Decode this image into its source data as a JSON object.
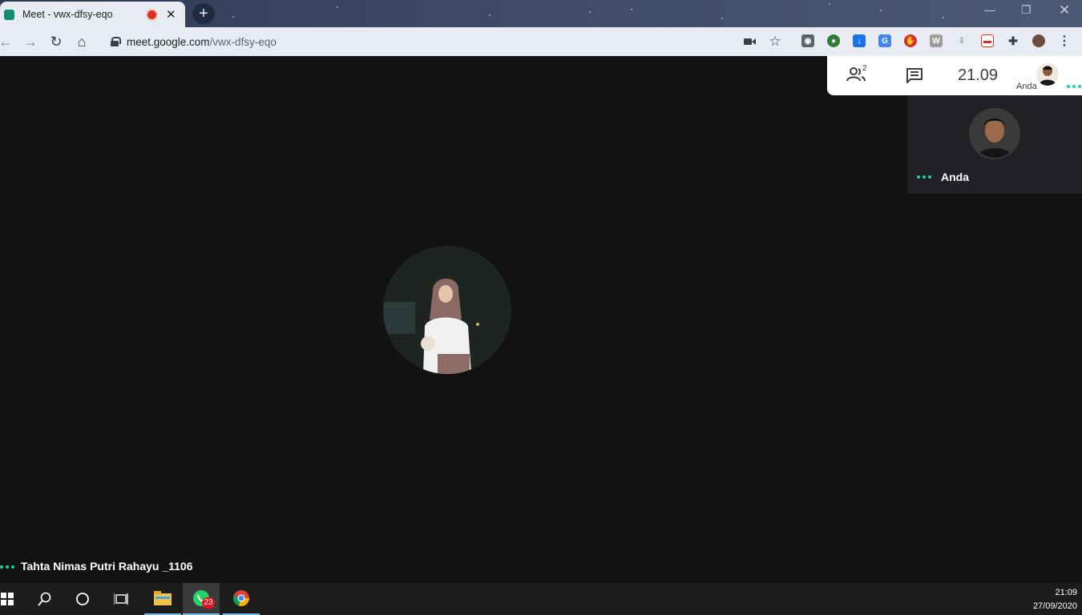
{
  "browser": {
    "tab_title": "Meet - vwx-dfsy-eqo",
    "url_host": "meet.google.com",
    "url_path": "/vwx-dfsy-eqo"
  },
  "meet": {
    "participant_count": "2",
    "clock": "21.09",
    "self_caption": "Anda",
    "self_tile_name": "Anda",
    "main_participant_name": "Tahta Nimas Putri Rahayu _1106",
    "accent_color": "#1fd1a8"
  },
  "taskbar": {
    "whatsapp_badge": "23",
    "time": "21:09",
    "date": "27/09/2020"
  },
  "icons": [
    "back-icon",
    "forward-icon",
    "reload-icon",
    "home-icon",
    "camera-icon",
    "star-icon",
    "people-icon",
    "chat-icon",
    "windows-start-icon",
    "search-icon",
    "cortana-icon",
    "task-view-icon",
    "file-explorer-icon",
    "whatsapp-icon",
    "chrome-icon"
  ]
}
